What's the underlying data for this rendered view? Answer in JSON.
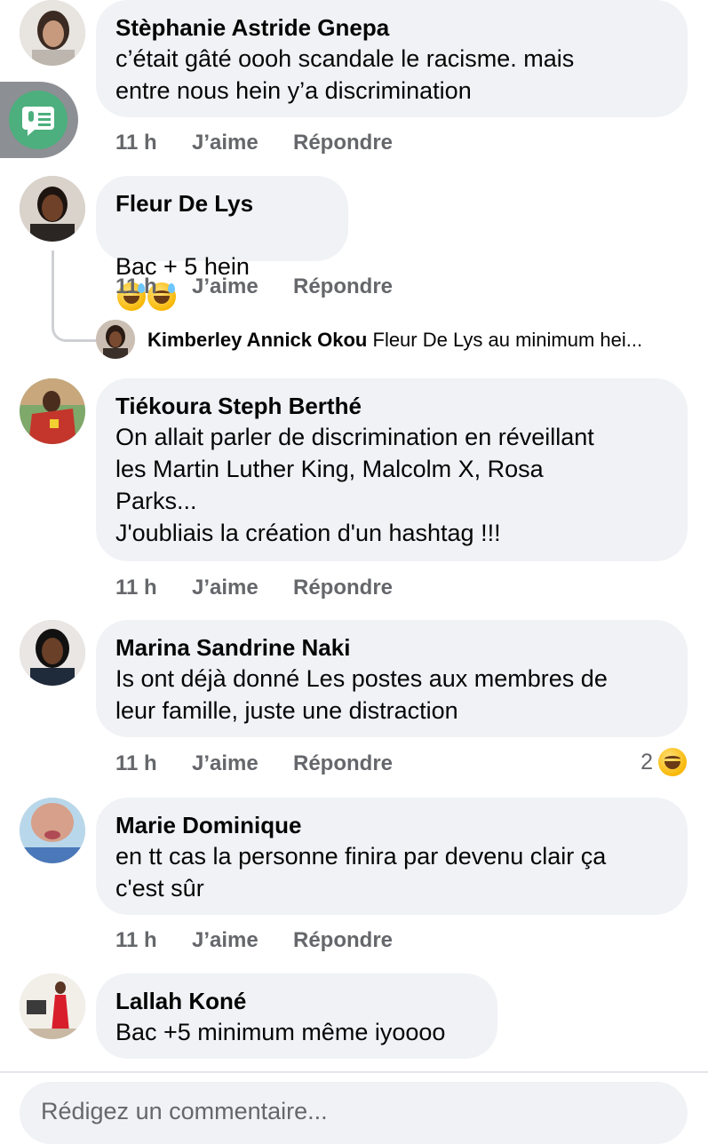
{
  "comments": [
    {
      "author": "Stèphanie Astride Gnepa",
      "text": "c’était gâté oooh scandale le racisme. mais\nentre nous  hein y’a discrimination",
      "time": "11 h",
      "like": "J’aime",
      "reply": "Répondre"
    },
    {
      "author": "Fleur De Lys",
      "text": "Bac + 5 hein",
      "emoji": [
        "grinning-sweat-emoji",
        "grinning-sweat-emoji"
      ],
      "time": "11 h",
      "like": "J’aime",
      "reply": "Répondre"
    },
    {
      "author": "Tiékoura Steph Berthé",
      "text": "On allait parler de discrimination en réveillant\nles Martin Luther King, Malcolm X, Rosa\nParks...\nJ'oubliais la création d'un hashtag !!!",
      "time": "11 h",
      "like": "J’aime",
      "reply": "Répondre"
    },
    {
      "author": "Marina Sandrine Naki",
      "text": "Is ont déjà donné Les postes aux membres de\nleur famille, juste une distraction",
      "time": "11 h",
      "like": "J’aime",
      "reply": "Répondre",
      "reaction_count": "2"
    },
    {
      "author": "Marie Dominique",
      "text": "en tt cas la personne finira par devenu clair ça\nc'est sûr",
      "time": "11 h",
      "like": "J’aime",
      "reply": "Répondre"
    },
    {
      "author": "Lallah Koné",
      "text": "Bac +5 minimum même iyoooo"
    }
  ],
  "reply_preview": {
    "author": "Kimberley Annick Okou",
    "text": "Fleur De Lys au minimum hei..."
  },
  "composer": {
    "placeholder": "Rédigez un commentaire..."
  },
  "colors": {
    "bubble": "#f0f2f5",
    "meta": "#65676b",
    "side_tab": "#4caf7d"
  }
}
